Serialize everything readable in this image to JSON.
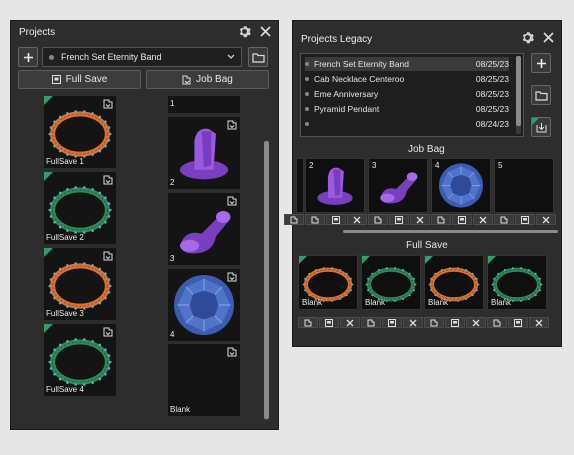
{
  "projects_panel": {
    "title": "Projects",
    "add_icon": "plus-icon",
    "selected_project": "French Set Eternity Band",
    "folder_icon": "folder-icon",
    "full_save_label": "Full Save",
    "job_bag_label": "Job Bag",
    "fullsave_items": [
      {
        "label": "FullSave 1",
        "color": "#e07030"
      },
      {
        "label": "FullSave 2",
        "color": "#2f8a5a"
      },
      {
        "label": "FullSave 3",
        "color": "#e07030"
      },
      {
        "label": "FullSave 4",
        "color": "#2f8a5a"
      }
    ],
    "jobbag_items": [
      {
        "label": "1"
      },
      {
        "label": "2"
      },
      {
        "label": "3"
      },
      {
        "label": "4"
      },
      {
        "label": "Blank"
      }
    ]
  },
  "legacy_panel": {
    "title": "Projects Legacy",
    "projects": [
      {
        "name": "French Set Eternity Band",
        "date": "08/25/23"
      },
      {
        "name": "Cab Necklace Centeroo",
        "date": "08/25/23"
      },
      {
        "name": "Eme Anniversary",
        "date": "08/25/23"
      },
      {
        "name": "Pyramid Pendant",
        "date": "08/25/23"
      },
      {
        "name": "",
        "date": "08/24/23"
      }
    ],
    "job_bag_title": "Job Bag",
    "job_bag_cells": [
      {
        "num": "2"
      },
      {
        "num": "3"
      },
      {
        "num": "4"
      },
      {
        "num": "5"
      }
    ],
    "full_save_title": "Full Save",
    "full_save_cells": [
      {
        "label": "Blank",
        "color": "#e07030"
      },
      {
        "label": "Blank",
        "color": "#2f8a5a"
      },
      {
        "label": "Blank",
        "color": "#e07030"
      },
      {
        "label": "Blank",
        "color": "#2f8a5a"
      }
    ]
  },
  "colors": {
    "accent_green": "#2fa06a",
    "purple": "#7a3fc0",
    "gem_blue": "#3b5db0"
  }
}
